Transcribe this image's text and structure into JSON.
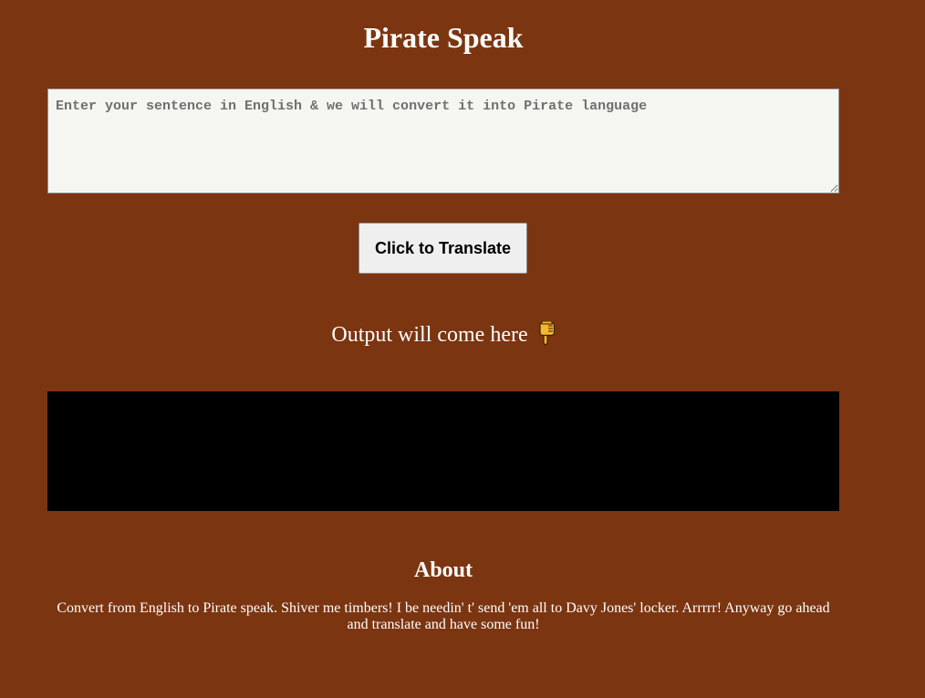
{
  "header": {
    "title": "Pirate Speak"
  },
  "input": {
    "placeholder": "Enter your sentence in English & we will convert it into Pirate language",
    "value": ""
  },
  "translate_button": {
    "label": "Click to Translate"
  },
  "output": {
    "label": "Output will come here",
    "icon": "pointing-down-hand-icon",
    "text": ""
  },
  "about": {
    "heading": "About",
    "text": "Convert from English to Pirate speak. Shiver me timbers! I be needin' t' send 'em all to Davy Jones' locker. Arrrrr! Anyway go ahead and translate and have some fun!"
  },
  "colors": {
    "background": "#7b3511",
    "input_background": "#f5f6f1",
    "output_background": "#000000",
    "text": "#ffffff"
  }
}
